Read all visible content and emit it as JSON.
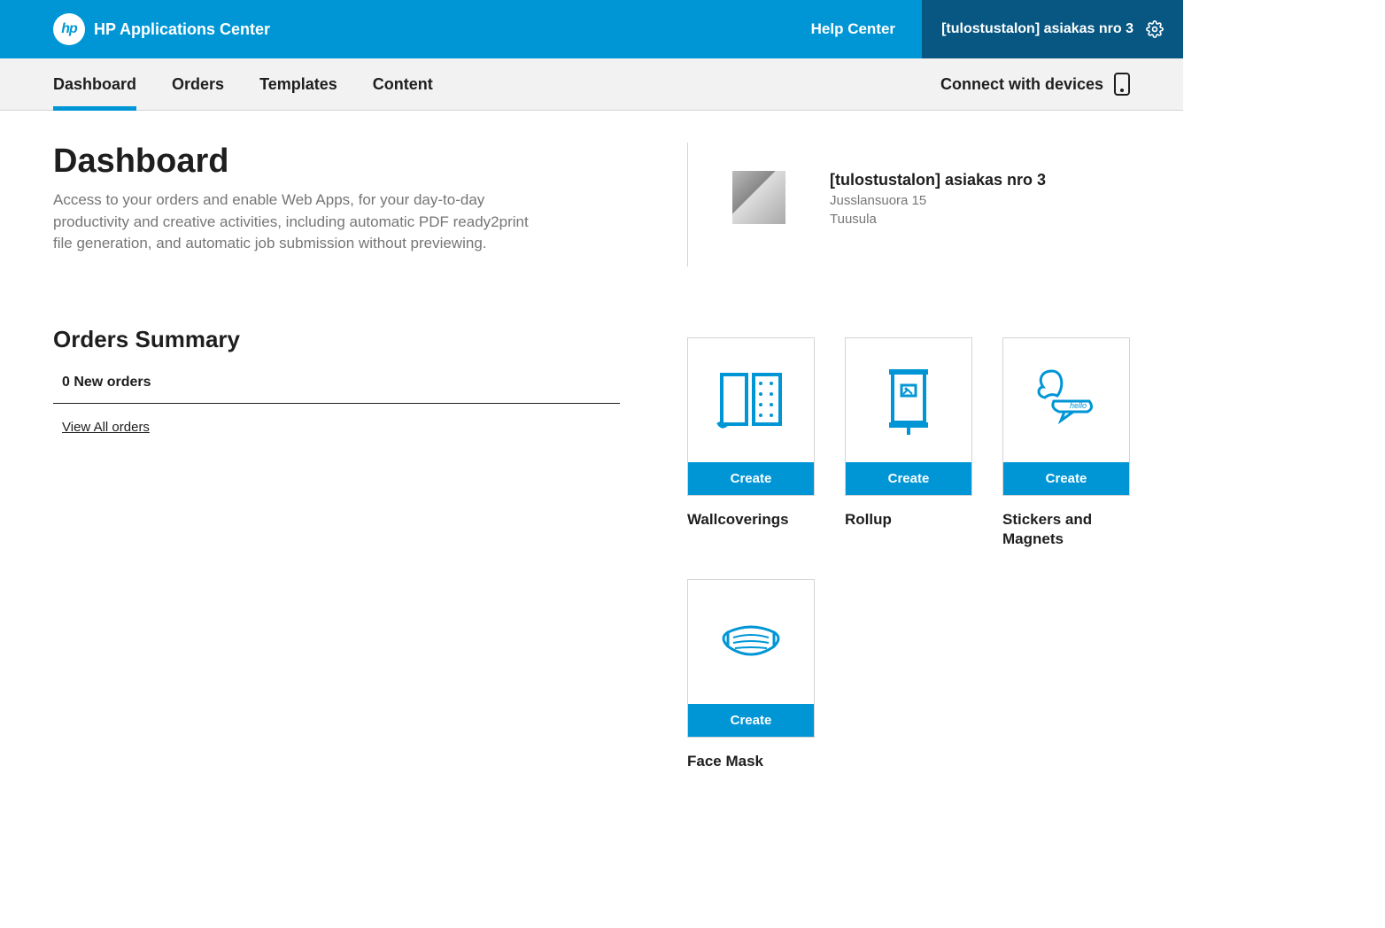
{
  "topbar": {
    "app_title": "HP Applications Center",
    "help_center": "Help Center",
    "account_label": "[tulostustalon] asiakas nro 3"
  },
  "nav": {
    "tabs": [
      "Dashboard",
      "Orders",
      "Templates",
      "Content"
    ],
    "active_index": 0,
    "connect_label": "Connect with devices"
  },
  "dashboard": {
    "title": "Dashboard",
    "description": "Access to your orders and enable Web Apps, for your day-to-day productivity and creative activities, including automatic PDF ready2print file generation, and automatic job submission without previewing."
  },
  "customer": {
    "name": "[tulostustalon] asiakas nro 3",
    "line1": "Jusslansuora 15",
    "line2": "Tuusula"
  },
  "orders": {
    "heading": "Orders Summary",
    "new_orders_line": "0 New orders",
    "view_all": "View All orders"
  },
  "apps": [
    {
      "label": "Wallcoverings",
      "button": "Create",
      "icon": "wallcoverings-icon"
    },
    {
      "label": "Rollup",
      "button": "Create",
      "icon": "rollup-icon"
    },
    {
      "label": "Stickers and Magnets",
      "button": "Create",
      "icon": "stickers-icon"
    },
    {
      "label": "Face Mask",
      "button": "Create",
      "icon": "facemask-icon"
    }
  ],
  "colors": {
    "accent": "#0096d6",
    "accent_dark": "#075782"
  }
}
